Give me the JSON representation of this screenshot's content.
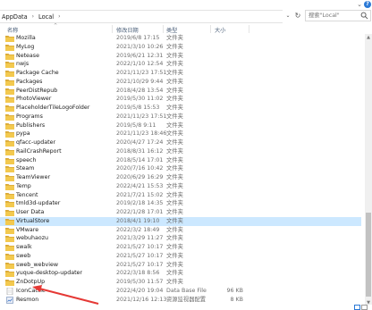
{
  "breadcrumb": {
    "items": [
      "AppData",
      "Local"
    ]
  },
  "search": {
    "placeholder": "搜索\"Local\""
  },
  "columns": {
    "name": "名称",
    "date": "修改日期",
    "type": "类型",
    "size": "大小"
  },
  "files": [
    {
      "name": "Mozilla",
      "date": "2019/6/8 17:15",
      "type": "文件夹",
      "size": "",
      "icon": "folder-icon"
    },
    {
      "name": "MyLog",
      "date": "2021/3/10 10:26",
      "type": "文件夹",
      "size": "",
      "icon": "folder-icon"
    },
    {
      "name": "Netease",
      "date": "2019/6/21 12:31",
      "type": "文件夹",
      "size": "",
      "icon": "folder-icon"
    },
    {
      "name": "nwjs",
      "date": "2022/1/10 12:54",
      "type": "文件夹",
      "size": "",
      "icon": "folder-icon"
    },
    {
      "name": "Package Cache",
      "date": "2021/11/23 17:51",
      "type": "文件夹",
      "size": "",
      "icon": "folder-icon"
    },
    {
      "name": "Packages",
      "date": "2021/10/29 9:44",
      "type": "文件夹",
      "size": "",
      "icon": "folder-icon"
    },
    {
      "name": "PeerDistRepub",
      "date": "2018/4/28 13:54",
      "type": "文件夹",
      "size": "",
      "icon": "folder-icon"
    },
    {
      "name": "PhotoViewer",
      "date": "2019/5/30 11:02",
      "type": "文件夹",
      "size": "",
      "icon": "folder-icon"
    },
    {
      "name": "PlaceholderTileLogoFolder",
      "date": "2019/5/8 15:53",
      "type": "文件夹",
      "size": "",
      "icon": "folder-icon"
    },
    {
      "name": "Programs",
      "date": "2021/11/23 17:51",
      "type": "文件夹",
      "size": "",
      "icon": "folder-icon"
    },
    {
      "name": "Publishers",
      "date": "2019/5/8 9:11",
      "type": "文件夹",
      "size": "",
      "icon": "folder-icon"
    },
    {
      "name": "pypa",
      "date": "2021/11/23 18:46",
      "type": "文件夹",
      "size": "",
      "icon": "folder-icon"
    },
    {
      "name": "qfacc-updater",
      "date": "2020/4/27 17:24",
      "type": "文件夹",
      "size": "",
      "icon": "folder-icon"
    },
    {
      "name": "RailCrashReport",
      "date": "2018/8/31 16:12",
      "type": "文件夹",
      "size": "",
      "icon": "folder-icon"
    },
    {
      "name": "speech",
      "date": "2018/5/14 17:01",
      "type": "文件夹",
      "size": "",
      "icon": "folder-icon"
    },
    {
      "name": "Steam",
      "date": "2020/7/16 10:42",
      "type": "文件夹",
      "size": "",
      "icon": "folder-icon"
    },
    {
      "name": "TeamViewer",
      "date": "2020/6/29 16:29",
      "type": "文件夹",
      "size": "",
      "icon": "folder-icon"
    },
    {
      "name": "Temp",
      "date": "2022/4/21 15:53",
      "type": "文件夹",
      "size": "",
      "icon": "folder-icon"
    },
    {
      "name": "Tencent",
      "date": "2021/7/21 15:02",
      "type": "文件夹",
      "size": "",
      "icon": "folder-icon"
    },
    {
      "name": "tmld3d-updater",
      "date": "2019/2/18 14:35",
      "type": "文件夹",
      "size": "",
      "icon": "folder-icon"
    },
    {
      "name": "User Data",
      "date": "2022/1/28 17:01",
      "type": "文件夹",
      "size": "",
      "icon": "folder-icon"
    },
    {
      "name": "VirtualStore",
      "date": "2018/4/1 19:10",
      "type": "文件夹",
      "size": "",
      "icon": "folder-icon",
      "selected": true
    },
    {
      "name": "VMware",
      "date": "2022/3/2 18:49",
      "type": "文件夹",
      "size": "",
      "icon": "folder-icon"
    },
    {
      "name": "webuhaozu",
      "date": "2021/3/29 11:27",
      "type": "文件夹",
      "size": "",
      "icon": "folder-icon"
    },
    {
      "name": "swalk",
      "date": "2021/5/27 10:17",
      "type": "文件夹",
      "size": "",
      "icon": "folder-icon"
    },
    {
      "name": "sweb",
      "date": "2021/5/27 10:17",
      "type": "文件夹",
      "size": "",
      "icon": "folder-icon"
    },
    {
      "name": "sweb_webview",
      "date": "2021/5/27 10:17",
      "type": "文件夹",
      "size": "",
      "icon": "folder-icon"
    },
    {
      "name": "yuque-desktop-updater",
      "date": "2022/3/18 8:56",
      "type": "文件夹",
      "size": "",
      "icon": "folder-icon"
    },
    {
      "name": "ZnDotpUp",
      "date": "2019/5/30 11:57",
      "type": "文件夹",
      "size": "",
      "icon": "folder-icon"
    },
    {
      "name": "IconCache",
      "date": "2022/4/20 19:04",
      "type": "Data Base File",
      "size": "96 KB",
      "icon": "database-file-icon"
    },
    {
      "name": "Resmon",
      "date": "2021/12/16 12:13",
      "type": "资源监视器配置",
      "size": "8 KB",
      "icon": "config-file-icon"
    }
  ],
  "colors": {
    "folder": "#f3c94f",
    "folder_dark": "#d9a937",
    "selection": "#cce8ff",
    "annotation_arrow": "#e53935"
  }
}
